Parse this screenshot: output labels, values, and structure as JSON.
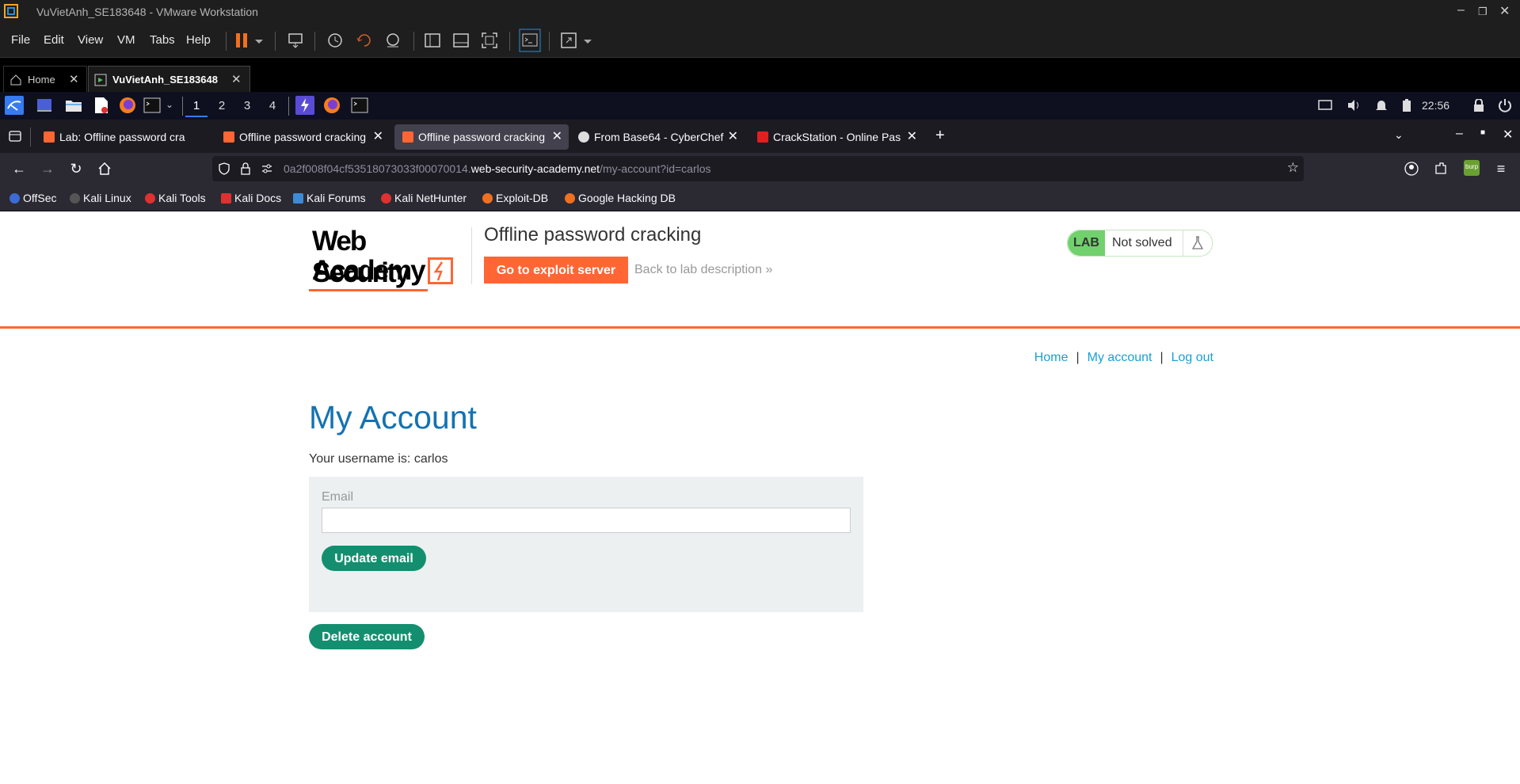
{
  "vmware": {
    "title": "VuVietAnh_SE183648 - VMware Workstation",
    "menu": [
      "File",
      "Edit",
      "View",
      "VM",
      "Tabs",
      "Help"
    ],
    "tabs": [
      {
        "label": "Home"
      },
      {
        "label": "VuVietAnh_SE183648"
      }
    ]
  },
  "kali_panel": {
    "workspaces": [
      "1",
      "2",
      "3",
      "4"
    ],
    "clock": "22:56"
  },
  "browser": {
    "tabs": [
      {
        "label": "Lab: Offline password cra",
        "favicon_color": "#ff6633"
      },
      {
        "label": "Offline password cracking",
        "favicon_color": "#ff6633"
      },
      {
        "label": "Offline password cracking",
        "favicon_color": "#ff6633",
        "active": true
      },
      {
        "label": "From Base64 - CyberChef",
        "favicon_color": "#dddddd"
      },
      {
        "label": "CrackStation - Online Pas",
        "favicon_color": "#e02020"
      }
    ],
    "url": {
      "prefix": "0a2f008f04cf53518073033f00070014.",
      "domain": "web-security-academy.net",
      "path": "/my-account?id=carlos"
    },
    "bookmarks": [
      {
        "label": "OffSec",
        "color": "#3d6bd6"
      },
      {
        "label": "Kali Linux",
        "color": "#2b2a33"
      },
      {
        "label": "Kali Tools",
        "color": "#e03030"
      },
      {
        "label": "Kali Docs",
        "color": "#e03030"
      },
      {
        "label": "Kali Forums",
        "color": "#3d8bd6"
      },
      {
        "label": "Kali NetHunter",
        "color": "#e03030"
      },
      {
        "label": "Exploit-DB",
        "color": "#f07020"
      },
      {
        "label": "Google Hacking DB",
        "color": "#f07020"
      }
    ]
  },
  "page": {
    "logo_line1": "Web Security",
    "logo_line2": "Academy",
    "lab_title": "Offline password cracking",
    "exploit_button": "Go to exploit server",
    "back_link": "Back to lab description",
    "lab_badge": "LAB",
    "lab_status": "Not solved",
    "nav": {
      "home": "Home",
      "my_account": "My account",
      "logout": "Log out",
      "separator": "|"
    },
    "heading": "My Account",
    "username_text": "Your username is: carlos",
    "email_label": "Email",
    "email_value": "",
    "update_button": "Update email",
    "delete_button": "Delete account"
  },
  "colors": {
    "accent": "#ff6633",
    "link": "#1a9fd6",
    "heading": "#1472b2",
    "button": "#138f6f",
    "lab_green": "#70d16d"
  }
}
